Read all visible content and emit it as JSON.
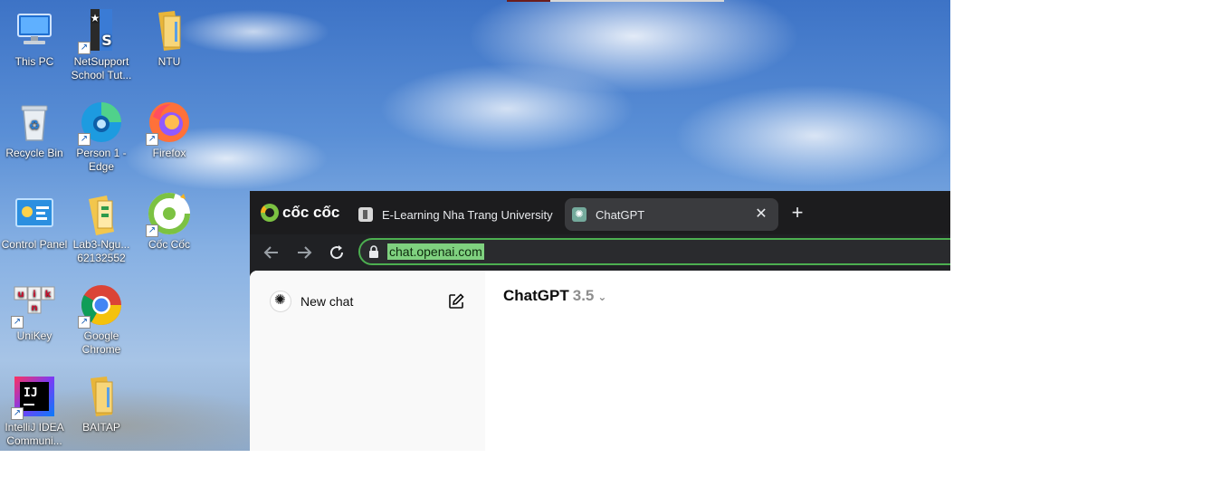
{
  "desktop": {
    "icons": [
      {
        "label": "This PC",
        "icon": "computer-icon"
      },
      {
        "label": "NetSupport School Tut...",
        "icon": "netsupport-icon"
      },
      {
        "label": "NTU",
        "icon": "folder-icon"
      },
      {
        "label": "Recycle Bin",
        "icon": "recycle-bin-icon"
      },
      {
        "label": "Person 1 - Edge",
        "icon": "edge-icon"
      },
      {
        "label": "Firefox",
        "icon": "firefox-icon"
      },
      {
        "label": "Control Panel",
        "icon": "control-panel-icon"
      },
      {
        "label": "Lab3-Ngu... 62132552",
        "icon": "archive-folder-icon"
      },
      {
        "label": "Cốc Cốc",
        "icon": "coccoc-icon"
      },
      {
        "label": "UniKey",
        "icon": "unikey-icon"
      },
      {
        "label": "Google Chrome",
        "icon": "chrome-icon"
      },
      {
        "label": "IntelliJ IDEA Communi...",
        "icon": "intellij-icon"
      },
      {
        "label": "BAITAP",
        "icon": "folder-icon"
      }
    ]
  },
  "browser": {
    "brand": "cốc cốc",
    "tabs": [
      {
        "title": "E-Learning Nha Trang University",
        "active": false
      },
      {
        "title": "ChatGPT",
        "active": true
      }
    ],
    "close_glyph": "✕",
    "new_tab_glyph": "+",
    "url": "chat.openai.com",
    "accent": "#4caf50"
  },
  "chatgpt": {
    "new_chat_label": "New chat",
    "model_name": "ChatGPT",
    "model_version": "3.5",
    "model_chevron": "⌄"
  }
}
